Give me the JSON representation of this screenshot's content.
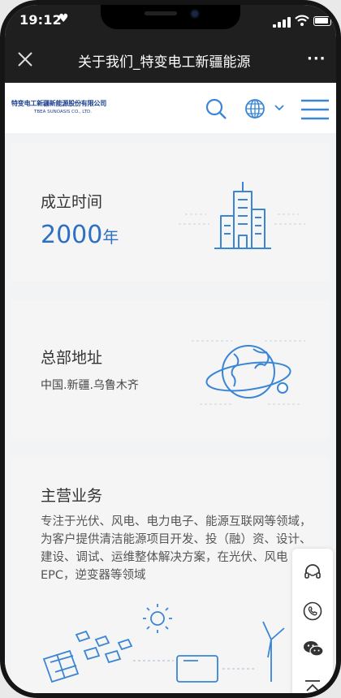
{
  "status": {
    "time": "19:12"
  },
  "titlebar": {
    "title": "关于我们_特变电工新疆能源"
  },
  "header": {
    "logo_cn": "特变电工新疆新能源股份有限公司",
    "logo_en": "TBEA SUNOASIS CO., LTD."
  },
  "cards": [
    {
      "title": "成立时间",
      "year": "2000",
      "year_unit": "年"
    },
    {
      "title": "总部地址",
      "address": "中国.新疆.乌鲁木齐"
    },
    {
      "title": "主营业务",
      "description": "专注于光伏、风电、电力电子、能源互联网等领域，为客户提供清洁能源项目开发、投（融）资、设计、建设、调试、运维整体解决方案，在光伏、风电EPC，逆变器等领域"
    }
  ],
  "colors": {
    "accent": "#2d6fc3",
    "dark_bar": "#1f1f1f",
    "card_bg": "#f5f5f6"
  },
  "icons": [
    "heart-icon",
    "signal-icon",
    "wifi-icon",
    "battery-icon",
    "close-icon",
    "more-icon",
    "search-icon",
    "globe-icon",
    "chevron-down-icon",
    "menu-icon",
    "headset-icon",
    "phone-icon",
    "wechat-icon",
    "back-to-top-icon"
  ]
}
